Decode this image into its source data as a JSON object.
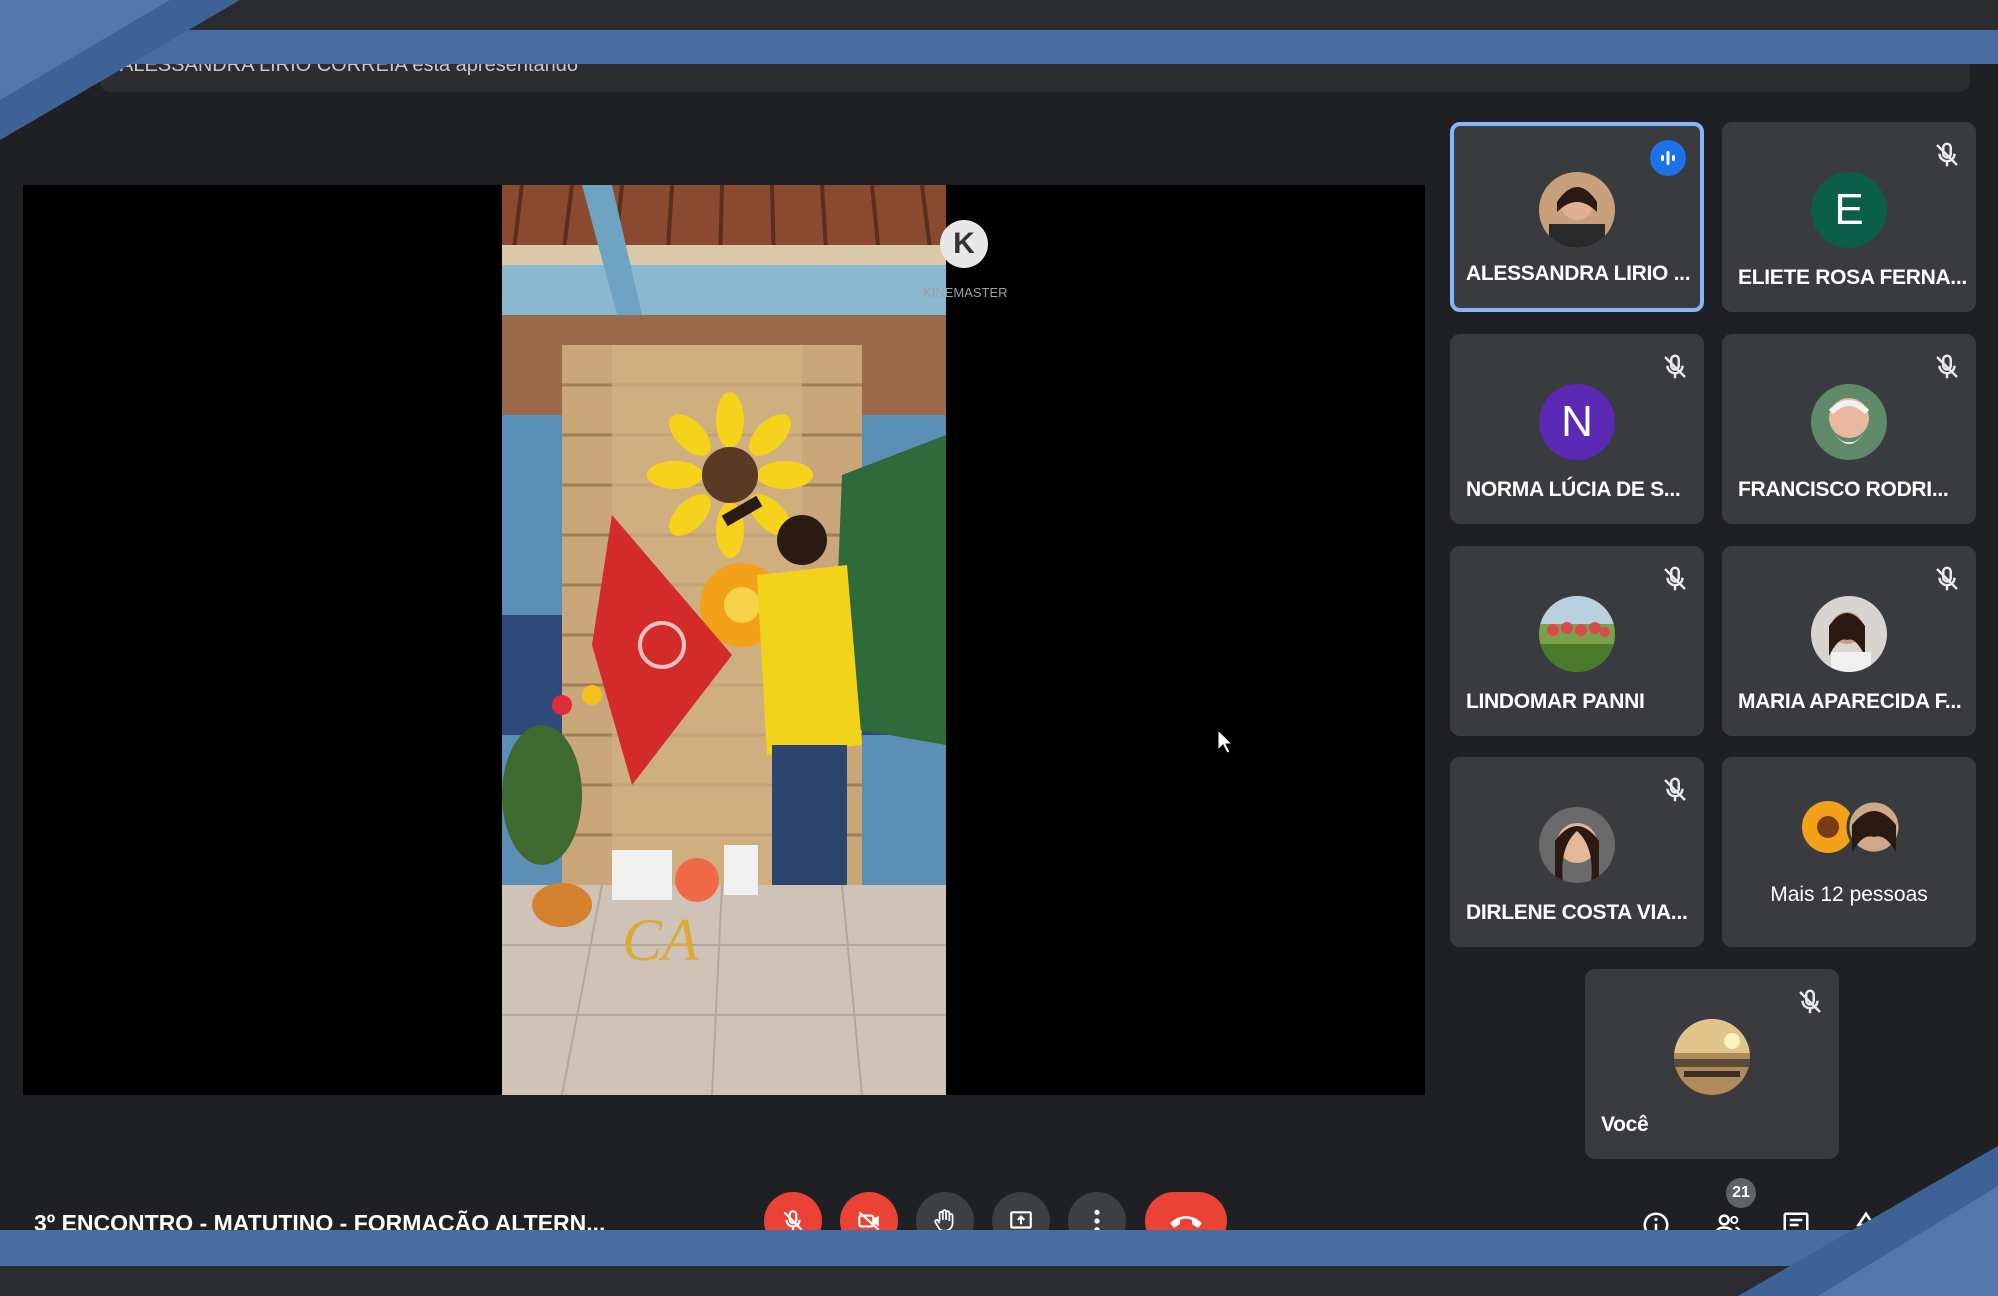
{
  "presenting_text": "ALESSANDRA LIRIO CORREIA está apresentando",
  "stage": {
    "watermark": "KINEMASTER"
  },
  "participants": [
    {
      "name": "ALESSANDRA LIRIO ...",
      "initial": "",
      "color": "",
      "speaking": true
    },
    {
      "name": "ELIETE ROSA FERNA...",
      "initial": "E",
      "color": "#0b5e47",
      "speaking": false
    },
    {
      "name": "NORMA LÚCIA DE S...",
      "initial": "N",
      "color": "#5b2ab5",
      "speaking": false
    },
    {
      "name": "FRANCISCO RODRI...",
      "initial": "",
      "color": "",
      "speaking": false
    },
    {
      "name": "LINDOMAR PANNI",
      "initial": "",
      "color": "",
      "speaking": false
    },
    {
      "name": "MARIA APARECIDA F...",
      "initial": "",
      "color": "",
      "speaking": false
    },
    {
      "name": "DIRLENE COSTA VIA...",
      "initial": "",
      "color": "",
      "speaking": false
    }
  ],
  "more_people": "Mais 12 pessoas",
  "self_name": "Você",
  "meeting_title": "3º ENCONTRO - MATUTINO - FORMAÇÃO ALTERN...",
  "participant_count": "21",
  "colors": {
    "accent_band": "#4a6da0",
    "background": "#1f2023",
    "tile": "#3a3b3e",
    "active_border": "#8ab4f8",
    "danger": "#ea4335"
  }
}
